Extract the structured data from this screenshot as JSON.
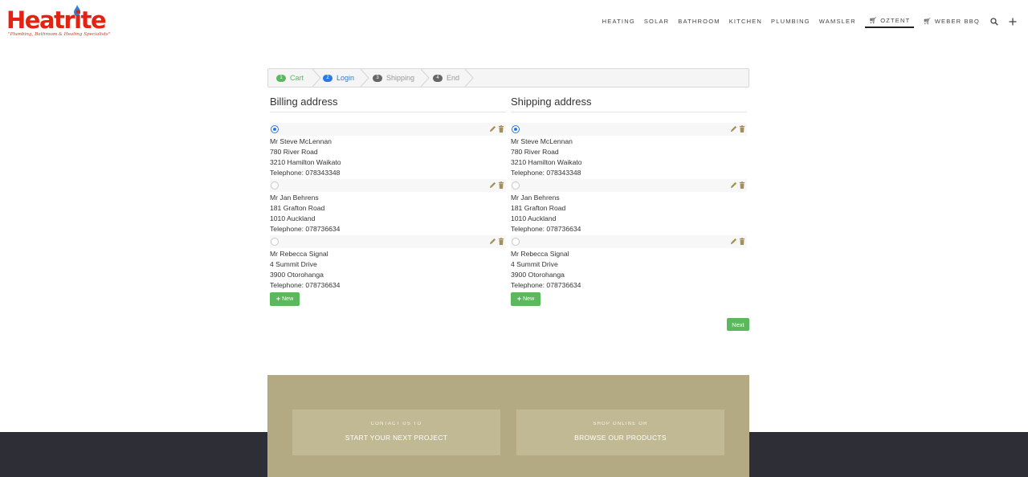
{
  "brand": {
    "name": "Heatrite",
    "trademark": "TM",
    "tagline": "\"Plumbing, Bathroom & Heating Specialists\""
  },
  "nav": {
    "items": [
      "HEATING",
      "SOLAR",
      "BATHROOM",
      "KITCHEN",
      "PLUMBING",
      "WAMSLER"
    ],
    "oztent": "OZTENT",
    "weber": "WEBER BBQ"
  },
  "steps": [
    {
      "num": "1",
      "label": "Cart",
      "state": "done"
    },
    {
      "num": "2",
      "label": "Login",
      "state": "current"
    },
    {
      "num": "3",
      "label": "Shipping",
      "state": "pending"
    },
    {
      "num": "4",
      "label": "End",
      "state": "pending"
    }
  ],
  "billing": {
    "title": "Billing address",
    "new_label": "New",
    "addresses": [
      {
        "name": "Mr Steve McLennan",
        "street": "780 River Road",
        "city": "3210 Hamilton Waikato",
        "phone": "Telephone: 078343348",
        "selected": true
      },
      {
        "name": "Mr Jan Behrens",
        "street": "181 Grafton Road",
        "city": "1010 Auckland",
        "phone": "Telephone: 078736634",
        "selected": false
      },
      {
        "name": "Mr Rebecca Signal",
        "street": "4 Summit Drive",
        "city": "3900 Otorohanga",
        "phone": "Telephone: 078736634",
        "selected": false
      }
    ]
  },
  "shipping": {
    "title": "Shipping address",
    "new_label": "New",
    "addresses": [
      {
        "name": "Mr Steve McLennan",
        "street": "780 River Road",
        "city": "3210 Hamilton Waikato",
        "phone": "Telephone: 078343348",
        "selected": true
      },
      {
        "name": "Mr Jan Behrens",
        "street": "181 Grafton Road",
        "city": "1010 Auckland",
        "phone": "Telephone: 078736634",
        "selected": false
      },
      {
        "name": "Mr Rebecca Signal",
        "street": "4 Summit Drive",
        "city": "3900 Otorohanga",
        "phone": "Telephone: 078736634",
        "selected": false
      }
    ]
  },
  "next_label": "Next",
  "footer": {
    "contact_small": "CONTACT US TO",
    "contact_big": "START YOUR NEXT PROJECT",
    "shop_small": "SHOP ONLINE OR",
    "shop_big": "BROWSE OUR PRODUCTS"
  },
  "colors": {
    "brand_red": "#e32212",
    "success_green": "#5cb85c",
    "link_blue": "#2a7ae2",
    "edit_icon_tan": "#a38f5a",
    "footer_panel": "#b3a982",
    "footer_dark": "#2d2e36"
  },
  "icons": {
    "edit": "pencil-icon",
    "delete": "trash-icon",
    "search": "search-icon",
    "menu": "plus-icon",
    "cart": "cart-icon"
  }
}
